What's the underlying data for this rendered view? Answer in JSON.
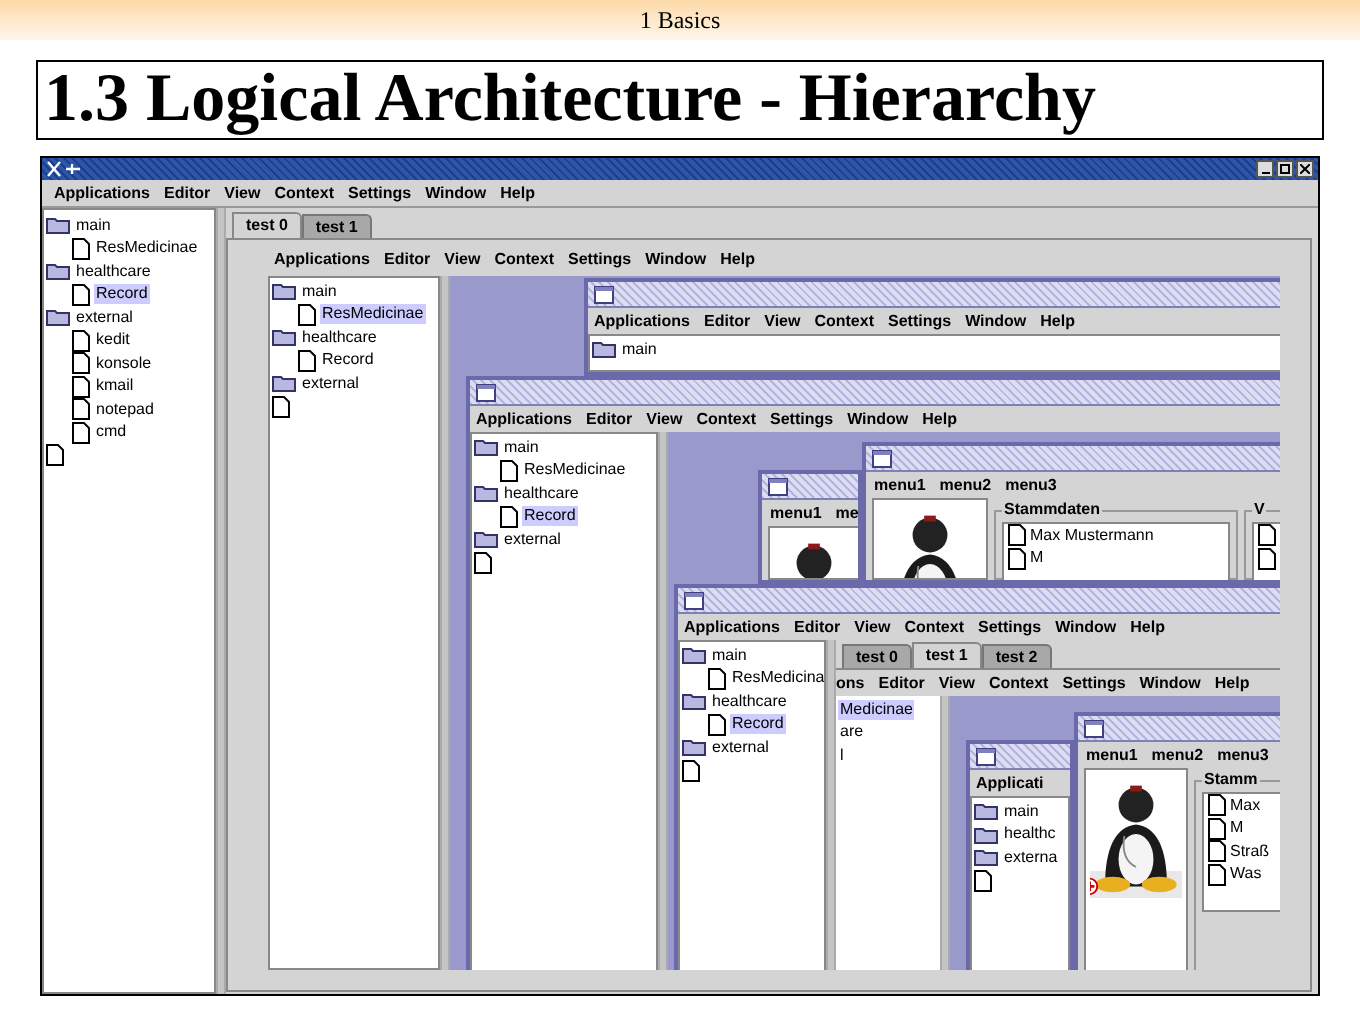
{
  "slide": {
    "section": "1 Basics",
    "title": "1.3 Logical Architecture - Hierarchy"
  },
  "app": {
    "menu": [
      "Applications",
      "Editor",
      "View",
      "Context",
      "Settings",
      "Window",
      "Help"
    ],
    "tree": [
      {
        "kind": "folder",
        "label": "main",
        "selected": false,
        "children": [
          {
            "kind": "doc",
            "label": "ResMedicinae",
            "selected": false
          }
        ]
      },
      {
        "kind": "folder",
        "label": "healthcare",
        "selected": false,
        "children": [
          {
            "kind": "doc",
            "label": "Record",
            "selected": true
          }
        ]
      },
      {
        "kind": "folder",
        "label": "external",
        "selected": false,
        "children": [
          {
            "kind": "doc",
            "label": "kedit",
            "selected": false
          },
          {
            "kind": "doc",
            "label": "konsole",
            "selected": false
          },
          {
            "kind": "doc",
            "label": "kmail",
            "selected": false
          },
          {
            "kind": "doc",
            "label": "notepad",
            "selected": false
          },
          {
            "kind": "doc",
            "label": "cmd",
            "selected": false
          }
        ]
      },
      {
        "kind": "doc",
        "selected": false
      }
    ],
    "tabs": [
      {
        "label": "test 0",
        "selected": true
      },
      {
        "label": "test 1",
        "selected": false
      }
    ],
    "tab_content": {
      "menu": [
        "Applications",
        "Editor",
        "View",
        "Context",
        "Settings",
        "Window",
        "Help"
      ],
      "tree": [
        {
          "kind": "folder",
          "label": "main",
          "selected": false,
          "children": [
            {
              "kind": "doc",
              "label": "ResMedicinae",
              "selected": true
            }
          ]
        },
        {
          "kind": "folder",
          "label": "healthcare",
          "selected": false,
          "children": [
            {
              "kind": "doc",
              "label": "Record",
              "selected": false
            }
          ]
        },
        {
          "kind": "folder",
          "label": "external",
          "selected": false
        },
        {
          "kind": "doc",
          "selected": false
        }
      ],
      "windows": [
        {
          "kind": "app",
          "menu": [
            "Applications",
            "Editor",
            "View",
            "Context",
            "Settings",
            "Window",
            "Help"
          ],
          "tree": [
            {
              "kind": "folder",
              "label": "main",
              "selected": false
            }
          ]
        },
        {
          "kind": "app",
          "menu": [
            "Applications",
            "Editor",
            "View",
            "Context",
            "Settings",
            "Window",
            "Help"
          ],
          "tree": [
            {
              "kind": "folder",
              "label": "main",
              "selected": false,
              "children": [
                {
                  "kind": "doc",
                  "label": "ResMedicinae",
                  "selected": false
                }
              ]
            },
            {
              "kind": "folder",
              "label": "healthcare",
              "selected": false,
              "children": [
                {
                  "kind": "doc",
                  "label": "Record",
                  "selected": true
                }
              ]
            },
            {
              "kind": "folder",
              "label": "external",
              "selected": false
            },
            {
              "kind": "doc",
              "selected": false
            }
          ],
          "windows": [
            {
              "kind": "record",
              "menu": [
                "menu1",
                "me"
              ],
              "picture": {
                "kind": "picture"
              }
            },
            {
              "kind": "record",
              "menu": [
                "menu1",
                "menu2",
                "menu3"
              ],
              "picture": {
                "kind": "picture"
              },
              "groups": [
                {
                  "title": "Stammdaten",
                  "items": [
                    {
                      "kind": "doc",
                      "label": "Max Mustermann"
                    },
                    {
                      "kind": "doc",
                      "label": "M"
                    }
                  ]
                },
                {
                  "title": "V",
                  "items": [
                    {
                      "kind": "doc"
                    },
                    {
                      "kind": "doc"
                    }
                  ]
                }
              ]
            },
            {
              "kind": "app",
              "menu": [
                "Applications",
                "Editor",
                "View",
                "Context",
                "Settings",
                "Window",
                "Help"
              ],
              "tree": [
                {
                  "kind": "folder",
                  "label": "main",
                  "selected": false,
                  "children": [
                    {
                      "kind": "doc",
                      "label": "ResMedicina",
                      "selected": false
                    }
                  ]
                },
                {
                  "kind": "folder",
                  "label": "healthcare",
                  "selected": false,
                  "children": [
                    {
                      "kind": "doc",
                      "label": "Record",
                      "selected": true
                    }
                  ]
                },
                {
                  "kind": "folder",
                  "label": "external",
                  "selected": false
                },
                {
                  "kind": "doc",
                  "selected": false
                }
              ],
              "tabs": [
                {
                  "label": "test 0",
                  "selected": false
                },
                {
                  "label": "test 1",
                  "selected": true
                },
                {
                  "label": "test 2",
                  "selected": false
                }
              ],
              "inner": {
                "menu": [
                  "ons",
                  "Editor",
                  "View",
                  "Context",
                  "Settings",
                  "Window",
                  "Help"
                ],
                "tree": [
                  {
                    "label": "Medicinae",
                    "selected": true
                  },
                  {
                    "label": "are",
                    "selected": false
                  },
                  {
                    "label": "l",
                    "selected": false
                  }
                ],
                "windows": [
                  {
                    "kind": "app",
                    "menu": [
                      "Applicati"
                    ],
                    "tree": [
                      {
                        "kind": "folder",
                        "label": "main",
                        "selected": false
                      },
                      {
                        "kind": "folder",
                        "label": "healthc",
                        "selected": false
                      },
                      {
                        "kind": "folder",
                        "label": "externa",
                        "selected": false
                      },
                      {
                        "kind": "doc",
                        "selected": false
                      }
                    ]
                  },
                  {
                    "kind": "record",
                    "menu": [
                      "menu1",
                      "menu2",
                      "menu3"
                    ],
                    "picture": {
                      "kind": "picture"
                    },
                    "groups": [
                      {
                        "title": "Stamm",
                        "items": [
                          {
                            "kind": "doc",
                            "label": "Max"
                          },
                          {
                            "kind": "doc",
                            "label": "M"
                          },
                          {
                            "kind": "doc",
                            "label": "Straß"
                          },
                          {
                            "kind": "doc",
                            "label": "Was"
                          }
                        ]
                      }
                    ]
                  }
                ]
              }
            }
          ]
        }
      ]
    }
  }
}
